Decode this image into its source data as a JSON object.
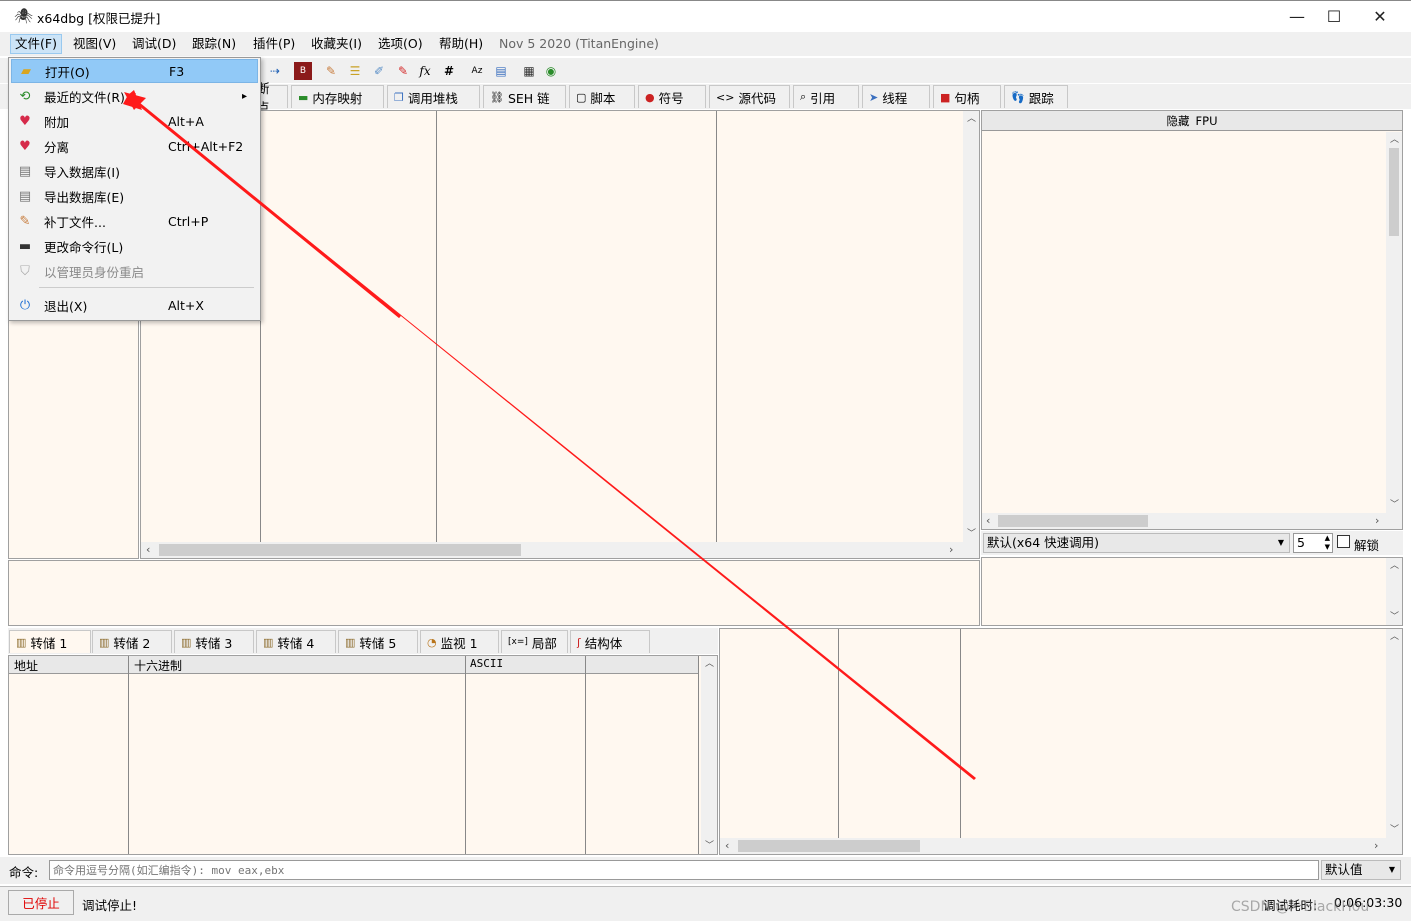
{
  "window": {
    "title": "x64dbg [权限已提升]",
    "minimize": "—",
    "maximize": "☐",
    "close": "✕"
  },
  "menubar": {
    "items": [
      "文件(F)",
      "视图(V)",
      "调试(D)",
      "跟踪(N)",
      "插件(P)",
      "收藏夹(I)",
      "选项(O)",
      "帮助(H)"
    ],
    "version": "Nov 5 2020 (TitanEngine)"
  },
  "tabs": [
    "断点",
    "内存映射",
    "调用堆栈",
    "SEH 链",
    "脚本",
    "符号",
    "源代码",
    "引用",
    "线程",
    "句柄",
    "跟踪"
  ],
  "file_menu": {
    "items": [
      {
        "label": "打开(O)",
        "shortcut": "F3",
        "icon": "folder-icon"
      },
      {
        "label": "最近的文件(R)",
        "shortcut": "",
        "icon": "recent-icon",
        "submenu": "▸"
      },
      {
        "label": "附加",
        "shortcut": "Alt+A",
        "icon": "heart-icon"
      },
      {
        "label": "分离",
        "shortcut": "Ctrl+Alt+F2",
        "icon": "broken-heart-icon"
      },
      {
        "label": "导入数据库(I)",
        "shortcut": "",
        "icon": "database-import-icon"
      },
      {
        "label": "导出数据库(E)",
        "shortcut": "",
        "icon": "database-export-icon"
      },
      {
        "label": "补丁文件...",
        "shortcut": "Ctrl+P",
        "icon": "patch-icon"
      },
      {
        "label": "更改命令行(L)",
        "shortcut": "",
        "icon": "terminal-icon"
      },
      {
        "label": "以管理员身份重启",
        "shortcut": "",
        "icon": "shield-icon",
        "disabled": true
      },
      {
        "label": "退出(X)",
        "shortcut": "Alt+X",
        "icon": "power-icon"
      }
    ]
  },
  "registers": {
    "header_hide": "隐藏",
    "header_fpu": "FPU",
    "calling_convention": "默认(x64 快速调用)",
    "arg_count": "5",
    "unlock_label": "解锁"
  },
  "dump_tabs": [
    "转储 1",
    "转储 2",
    "转储 3",
    "转储 4",
    "转储 5",
    "监视 1",
    "局部",
    "结构体"
  ],
  "dump_locals_prefix": "[x=]",
  "dump_columns": [
    "地址",
    "十六进制",
    "ASCII"
  ],
  "command": {
    "label": "命令:",
    "placeholder": "命令用逗号分隔(如汇编指令): mov eax,ebx",
    "mode": "默认值"
  },
  "status": {
    "state": "已停止",
    "message": "调试停止!",
    "time_label": "调试耗时:",
    "time_value": "0:06:03:30",
    "watermark": "CSDN @一BlackHou"
  },
  "colors": {
    "pane_bg": "#fff8f0",
    "stopped": "#e00000",
    "annotation_arrow": "#ff1a1a",
    "menu_highlight": "#91c9f7"
  }
}
